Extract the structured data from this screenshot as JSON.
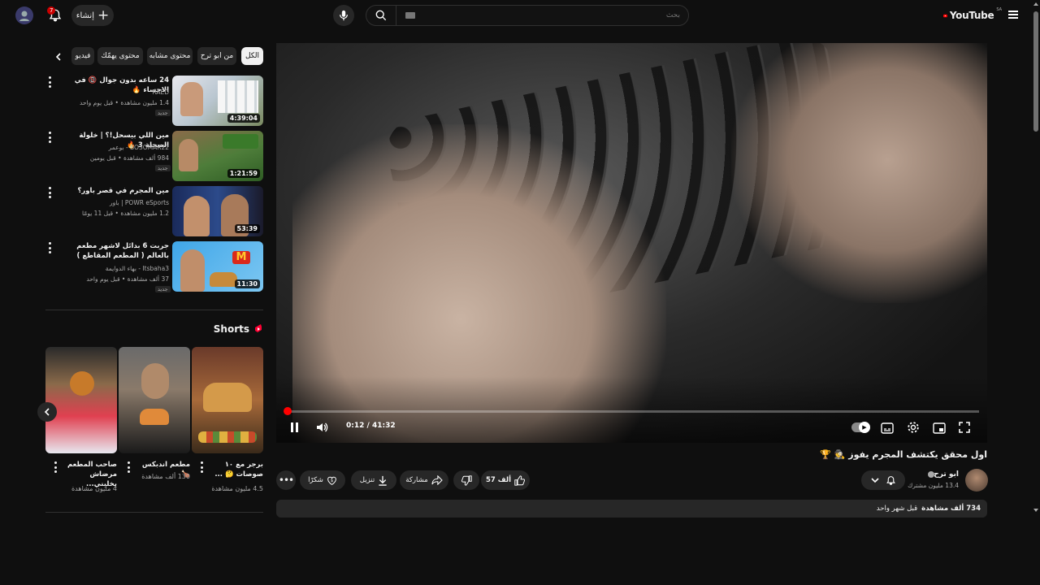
{
  "header": {
    "logo_text": "YouTube",
    "region": "SA",
    "search_placeholder": "بحث",
    "create_label": "إنشاء",
    "notification_count": "7"
  },
  "chips": [
    {
      "label": "الكل",
      "active": true
    },
    {
      "label": "من ابو ترح"
    },
    {
      "label": "محتوى مشابه"
    },
    {
      "label": "محتوى يهمّك"
    },
    {
      "label": "فيديو"
    }
  ],
  "related": [
    {
      "title": "24 ساعه بدون جوال 📵 في الاحساء 🔥",
      "channel": "RAED",
      "meta": "1.4 مليون مشاهدة • قبل يوم واحد",
      "badge": "جديد",
      "duration": "4:39:04"
    },
    {
      "title": "مين اللي بيسحل!؟ | خلولة الصحلة 3 🔥",
      "channel": "BO3OMAR22 - بوعمر",
      "meta": "984 ألف مشاهدة • قبل يومين",
      "badge": "جديد",
      "duration": "1:21:59"
    },
    {
      "title": "مين المجرم في قصر باور؟",
      "channel": "POWR eSports | باور",
      "meta": "1.2 مليون مشاهدة • قبل 11 يومًا",
      "badge": "",
      "duration": "53:39"
    },
    {
      "title": "جربت 6 بدائل لاشهر مطعم بالعالم ( المطعم المقاطع )",
      "channel": "Itsbaha3 - بهاء الدوايمة",
      "meta": "37 ألف مشاهدة • قبل يوم واحد",
      "badge": "جديد",
      "duration": "11:30"
    }
  ],
  "shorts": {
    "heading": "Shorts",
    "items": [
      {
        "title": "صاحب المطعم مرضاش يخليني...",
        "meta": "4 مليون مشاهدة"
      },
      {
        "title": "مطعم اندبكس 🍗",
        "meta": "130 ألف مشاهدة"
      },
      {
        "title": "برجر مع ١٠ صوصات 🤔 ...",
        "meta": "4.5 مليون مشاهدة"
      }
    ]
  },
  "player": {
    "time": "0:12 / 41:32",
    "progress": 0.005
  },
  "video": {
    "title": "اول محقق يكتشف المجرم يفوز 🕵️ 🏆",
    "channel": "ابو ترح",
    "subscribers": "13.4 مليون مشترك",
    "likes": "57 ألف",
    "share": "مشاركة",
    "download": "تنزيل",
    "thanks": "شكرًا",
    "views": "734 ألف مشاهدة",
    "date": "قبل شهر واحد"
  }
}
